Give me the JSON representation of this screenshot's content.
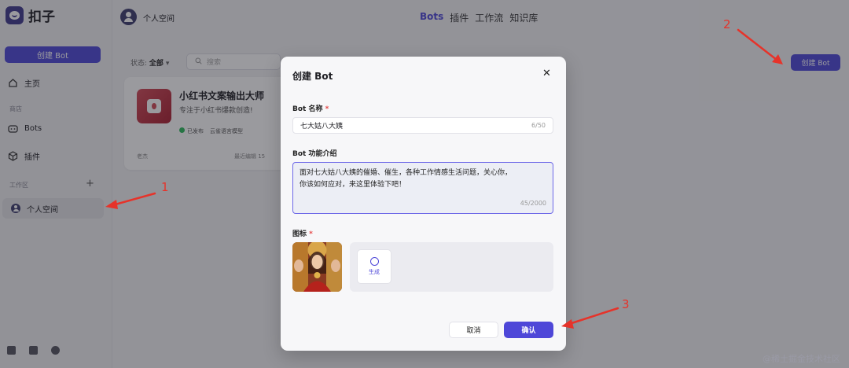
{
  "app": {
    "name": "扣子"
  },
  "sidebar": {
    "create_label": "创建 Bot",
    "home_label": "主页",
    "store_section": "商店",
    "bots_label": "Bots",
    "plugins_label": "插件",
    "workspace_section": "工作区",
    "add_symbol": "+",
    "personal_space": "个人空间"
  },
  "topbar": {
    "workspace_name": "个人空间",
    "tabs": [
      {
        "label": "Bots",
        "active": true
      },
      {
        "label": "插件",
        "active": false
      },
      {
        "label": "工作流",
        "active": false
      },
      {
        "label": "知识库",
        "active": false
      }
    ],
    "create_label": "创建 Bot"
  },
  "list": {
    "filter_label": "状态:",
    "filter_value": "全部",
    "search_placeholder": "搜索"
  },
  "card": {
    "title": "小红书文案输出大师",
    "description": "专注于小红书爆款创造!",
    "status": "已发布",
    "model": "云雀语言模型",
    "owner": "老杰",
    "edited": "最近编辑 15"
  },
  "modal": {
    "title": "创建 Bot",
    "close_symbol": "✕",
    "name_label": "Bot 名称",
    "name_value": "七大姑八大姨",
    "name_counter": "6/50",
    "desc_label": "Bot 功能介绍",
    "desc_line1": "面对七大姑八大姨的催婚、催生，各种工作情感生活问题，关心你，",
    "desc_line2": "你该如何应对，来这里体验下吧！",
    "desc_counter": "45/2000",
    "icon_label": "图标",
    "required_mark": "*",
    "generate_label": "生成",
    "cancel_label": "取消",
    "confirm_label": "确认"
  },
  "annotations": {
    "one": "1",
    "two": "2",
    "three": "3"
  },
  "watermark": "@稀土掘金技术社区",
  "colors": {
    "accent": "#4e47d8",
    "arrow": "#e6332a",
    "required": "#e54545"
  }
}
